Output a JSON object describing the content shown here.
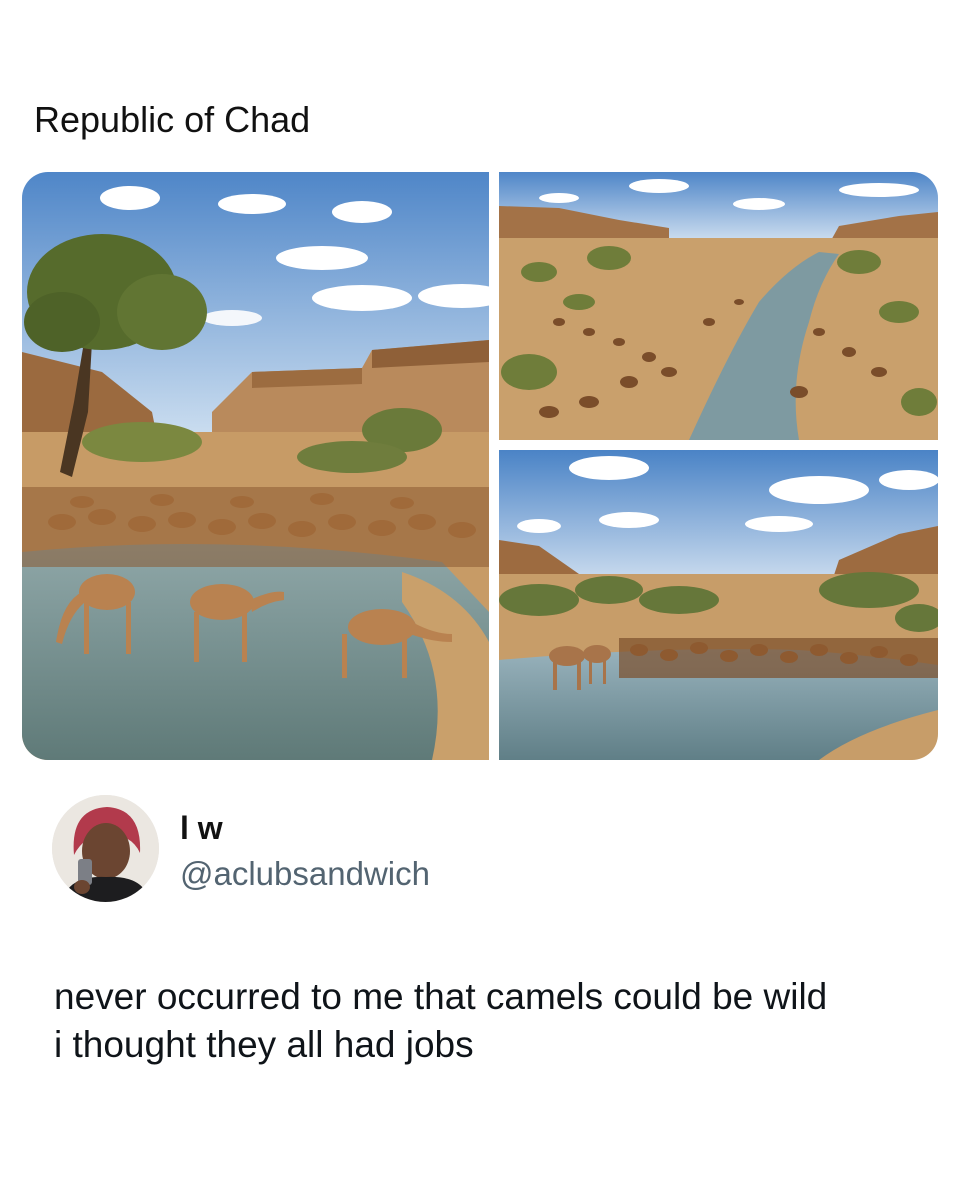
{
  "post": {
    "caption": "Republic of Chad",
    "author": {
      "display_name": "l w",
      "handle": "@aclubsandwich"
    },
    "text_lines": [
      "never occurred to me that camels could be wild",
      "i thought they all had jobs"
    ]
  },
  "colors": {
    "text_primary": "#0f1419",
    "text_secondary": "#536471",
    "background": "#ffffff"
  },
  "icons": {
    "avatar": "profile-photo"
  }
}
